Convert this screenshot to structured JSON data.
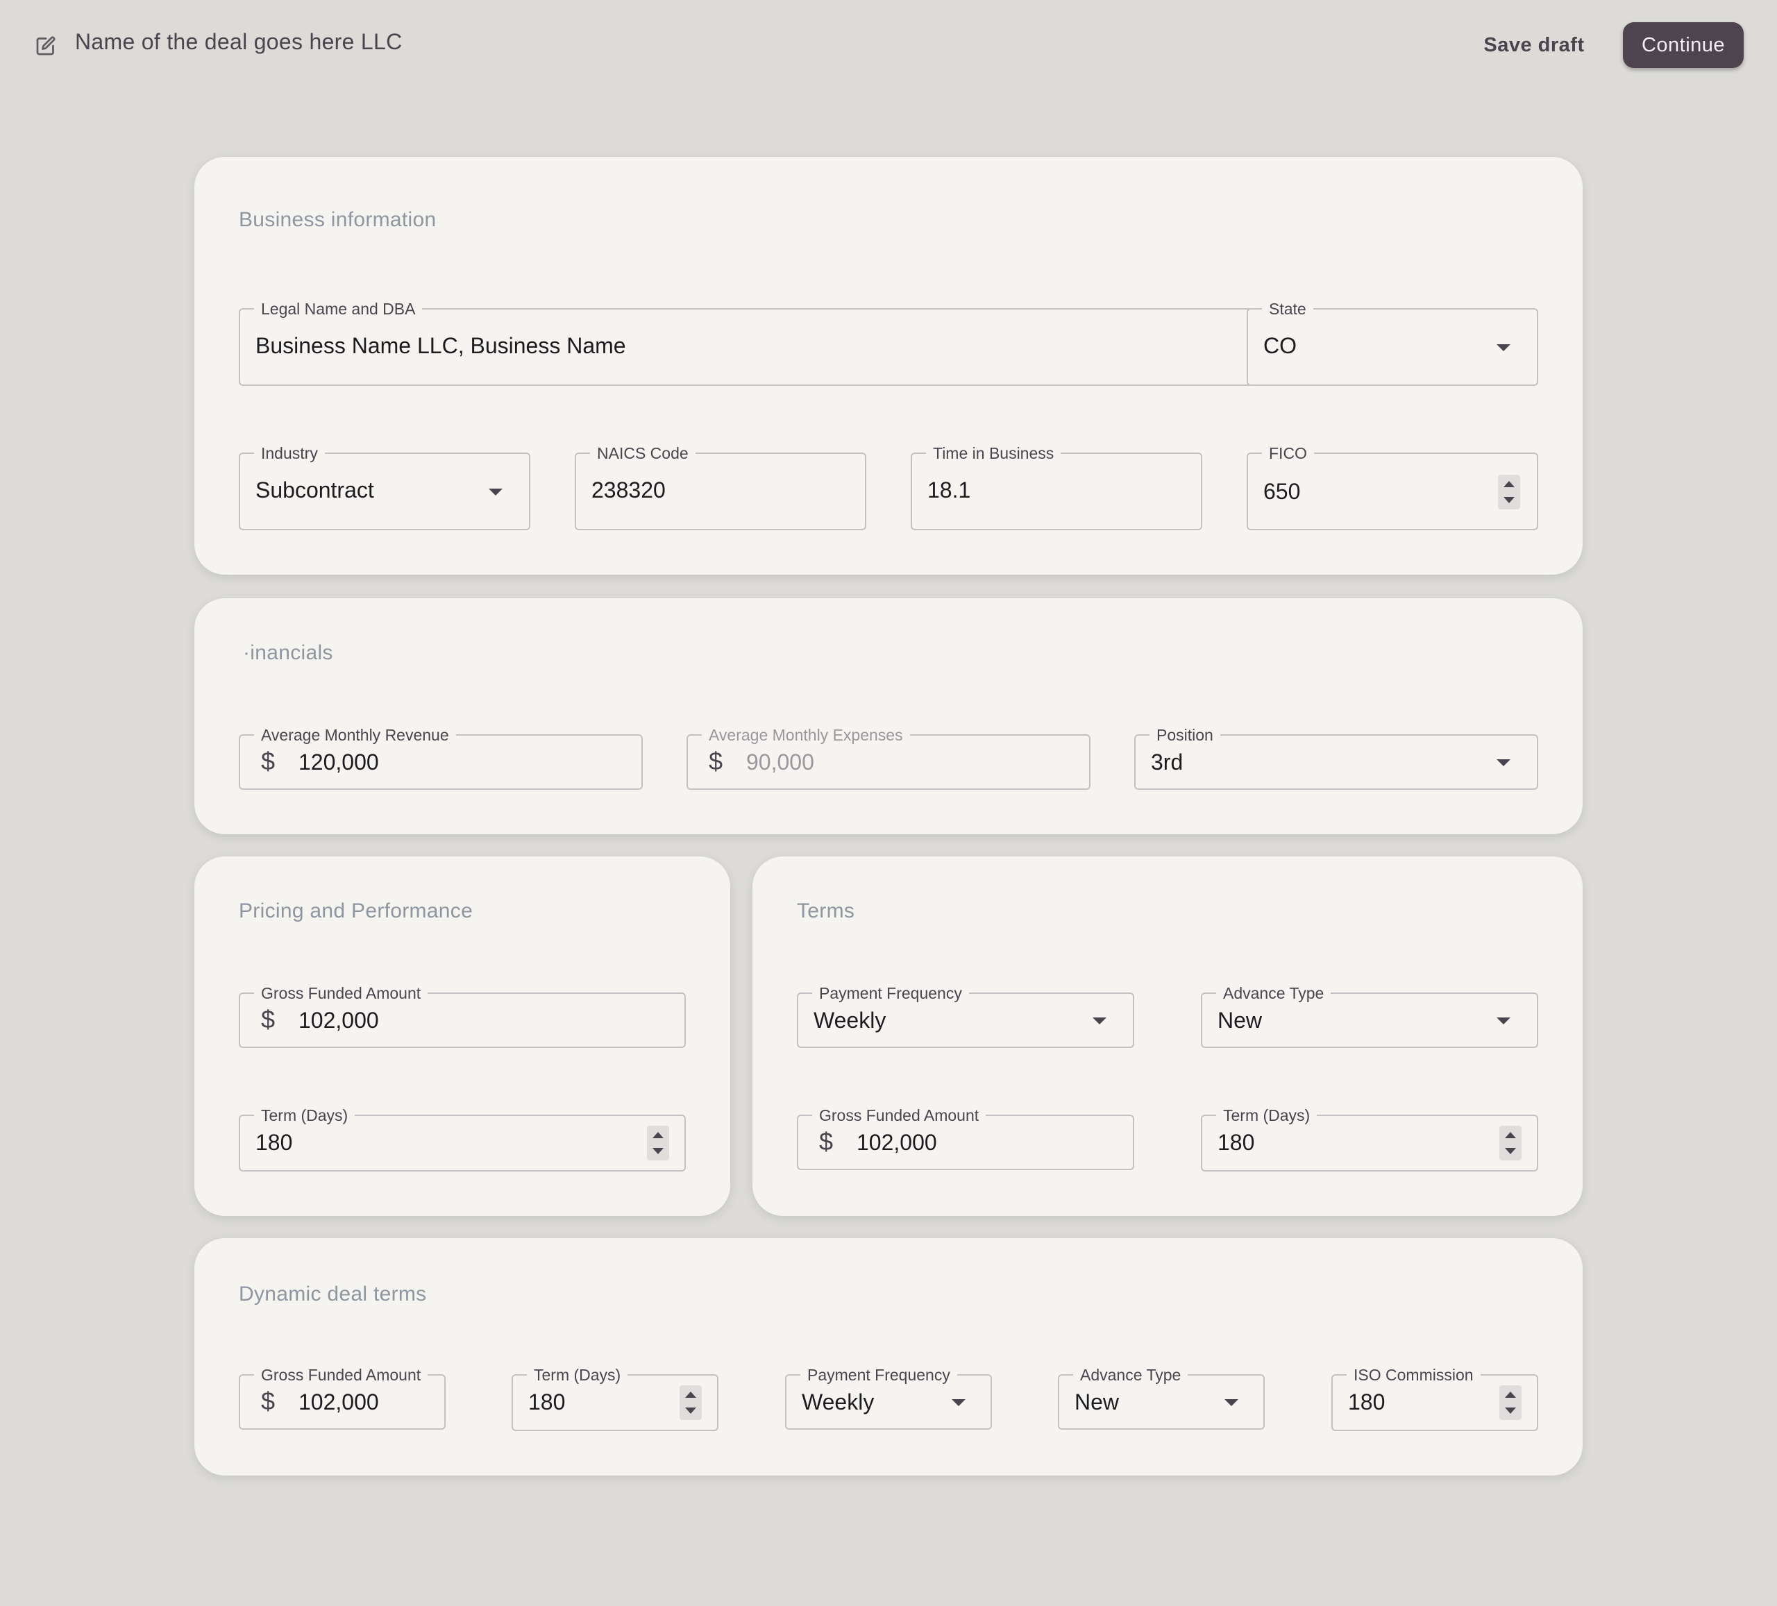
{
  "header": {
    "deal_title": "Name of the deal goes here LLC",
    "save_draft_label": "Save draft",
    "continue_label": "Continue"
  },
  "business_information": {
    "title": "Business information",
    "legal_name": {
      "label": "Legal Name and DBA",
      "value": "Business Name LLC, Business Name"
    },
    "state": {
      "label": "State",
      "value": "CO"
    },
    "industry": {
      "label": "Industry",
      "value": "Subcontract"
    },
    "naics": {
      "label": "NAICS Code",
      "value": "238320"
    },
    "time_in_business": {
      "label": "Time in Business",
      "value": "18.1"
    },
    "fico": {
      "label": "FICO",
      "value": "650"
    }
  },
  "financials": {
    "title": "·inancials",
    "avg_revenue": {
      "label": "Average Monthly Revenue",
      "value": "120,000"
    },
    "avg_expenses": {
      "label": "Average Monthly Expenses",
      "value": "90,000"
    },
    "position": {
      "label": "Position",
      "value": "3rd"
    }
  },
  "pricing": {
    "title": "Pricing and Performance",
    "gross_funded": {
      "label": "Gross Funded Amount",
      "value": "102,000"
    },
    "term_days": {
      "label": "Term (Days)",
      "value": "180"
    }
  },
  "terms": {
    "title": "Terms",
    "payment_frequency": {
      "label": "Payment Frequency",
      "value": "Weekly"
    },
    "advance_type": {
      "label": "Advance Type",
      "value": "New"
    },
    "gross_funded": {
      "label": "Gross Funded Amount",
      "value": "102,000"
    },
    "term_days": {
      "label": "Term (Days)",
      "value": "180"
    }
  },
  "dynamic_terms": {
    "title": "Dynamic deal terms",
    "gross_funded": {
      "label": "Gross Funded Amount",
      "value": "102,000"
    },
    "term_days": {
      "label": "Term (Days)",
      "value": "180"
    },
    "payment_frequency": {
      "label": "Payment Frequency",
      "value": "Weekly"
    },
    "advance_type": {
      "label": "Advance Type",
      "value": "New"
    },
    "iso_commission": {
      "label": "ISO Commission",
      "value": "180"
    }
  },
  "currency_symbol": "$",
  "colors": {
    "primary": "#4e444f",
    "background": "#dcdbd7",
    "card": "#f5f4f0",
    "section_title": "#8e96a0"
  }
}
